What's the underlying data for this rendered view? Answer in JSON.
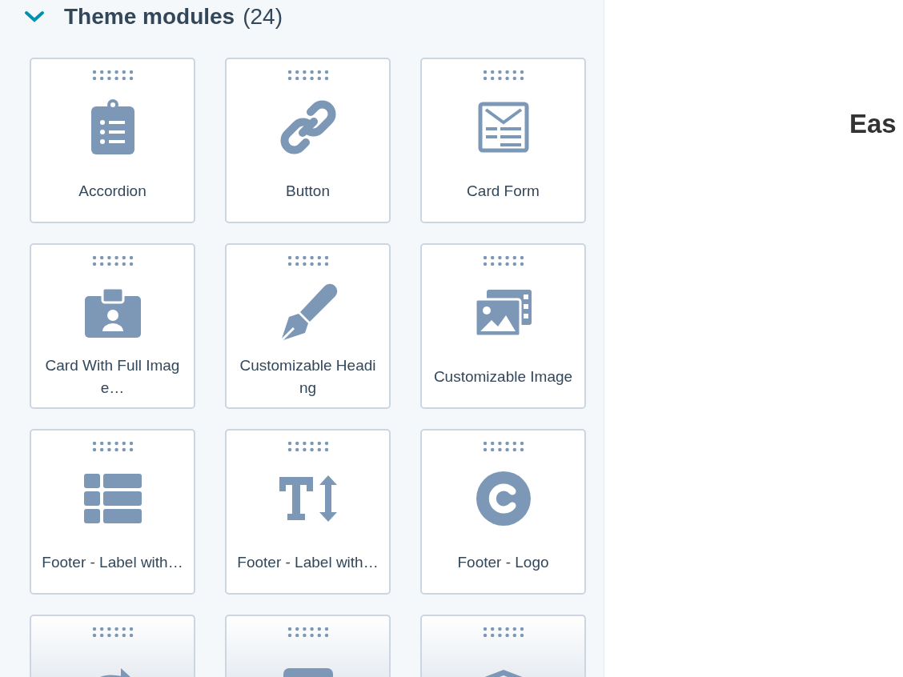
{
  "section": {
    "title": "Theme modules",
    "count": "(24)",
    "expanded": true
  },
  "modules": [
    {
      "label": "Accordion",
      "cut_off": false
    },
    {
      "label": "Button",
      "cut_off": false
    },
    {
      "label": "Card Form",
      "cut_off": false
    },
    {
      "label": "Card With Full Image…",
      "cut_off": false
    },
    {
      "label": "Customizable Heading",
      "cut_off": false
    },
    {
      "label": "Customizable Image",
      "cut_off": false
    },
    {
      "label": "Footer - Label with…",
      "cut_off": false
    },
    {
      "label": "Footer - Label with…",
      "cut_off": false
    },
    {
      "label": "Footer - Logo",
      "cut_off": false
    },
    {
      "cut_off": true
    },
    {
      "cut_off": true
    },
    {
      "cut_off": true
    }
  ],
  "preview": {
    "heading": "Eas"
  }
}
